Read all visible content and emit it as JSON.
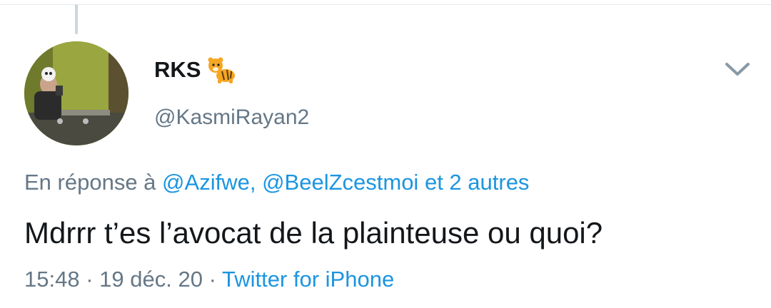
{
  "tweet": {
    "display_name": "RKS",
    "handle": "@KasmiRayan2",
    "reply_prefix": "En réponse à",
    "reply_mentions": [
      "@Azifwe,",
      "@BeelZcestmoi"
    ],
    "reply_suffix": "et 2 autres",
    "text": "Mdrrr t’es l’avocat de la plainteuse ou quoi?",
    "time": "15:48",
    "date": "19 déc. 20",
    "separator": "·",
    "source": "Twitter for iPhone"
  },
  "icons": {
    "name_emoji": "tiger-icon",
    "menu": "chevron-down-icon"
  },
  "colors": {
    "link": "#1b95e0",
    "secondary_text": "#657786",
    "primary_text": "#14171a"
  }
}
